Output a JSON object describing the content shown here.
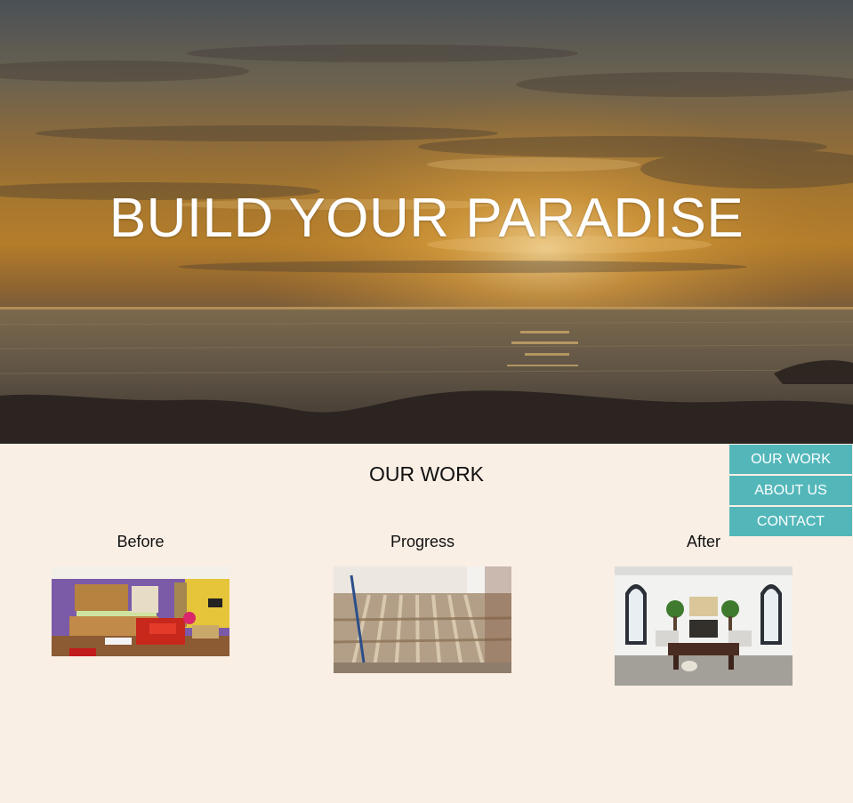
{
  "hero": {
    "title": "BUILD YOUR PARADISE"
  },
  "nav": {
    "items": [
      {
        "label": "OUR WORK"
      },
      {
        "label": "ABOUT US"
      },
      {
        "label": "CONTACT"
      }
    ]
  },
  "work": {
    "title": "OUR WORK",
    "columns": [
      {
        "label": "Before",
        "image": "colorful-kitchen-living-room-photo"
      },
      {
        "label": "Progress",
        "image": "floor-joists-construction-photo"
      },
      {
        "label": "After",
        "image": "renovated-white-living-room-photo"
      }
    ]
  },
  "colors": {
    "accent": "#53b7ba",
    "page_background": "#faefe5",
    "hero_text": "#ffffff"
  }
}
